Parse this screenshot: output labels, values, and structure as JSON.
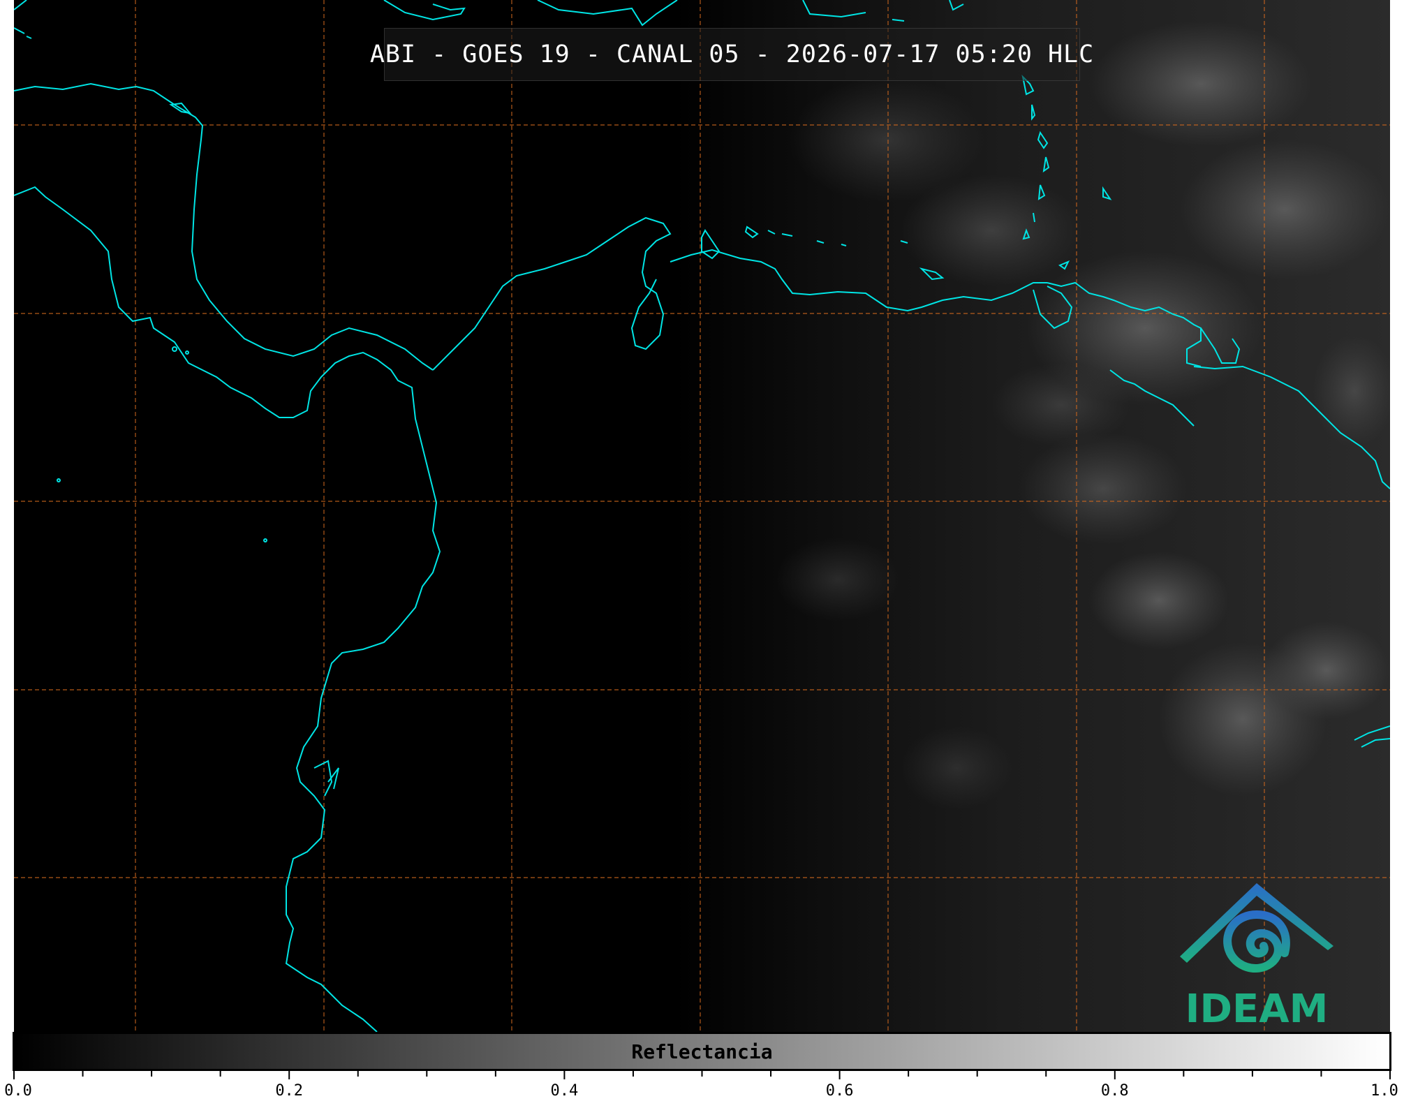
{
  "title": "ABI - GOES 19 - CANAL 05 - 2026-07-17 05:20 HLC",
  "logo": {
    "text": "IDEAM",
    "icon": "ideam-logo-icon"
  },
  "colorbar": {
    "label": "Reflectancia",
    "range": [
      0.0,
      1.0
    ],
    "tick_labels": [
      "0.0",
      "0.2",
      "0.4",
      "0.6",
      "0.8",
      "1.0"
    ],
    "colormap": [
      "#000000",
      "#ffffff"
    ]
  },
  "colors": {
    "coastline": "#00e5e5",
    "gridlines": "#d2691e",
    "background": "#000000"
  }
}
